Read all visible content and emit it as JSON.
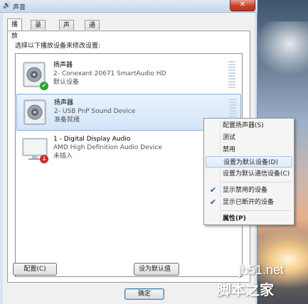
{
  "window": {
    "title": "声音",
    "close_glyph": "✕"
  },
  "tabs": [
    {
      "label": "播放",
      "active": true
    },
    {
      "label": "录制",
      "active": false
    },
    {
      "label": "声音",
      "active": false
    },
    {
      "label": "通信",
      "active": false
    }
  ],
  "prompt": "选择以下播放设备来修改设置:",
  "devices": [
    {
      "name": "扬声器",
      "desc": "2- Conexant 20671 SmartAudio HD",
      "status": "默认设备",
      "icon": "speaker-icon",
      "badge": "checkmark",
      "badge_color": "#2aa52a"
    },
    {
      "name": "扬声器",
      "desc": "2- USB PnP Sound Device",
      "status": "准备就绪",
      "icon": "speaker-icon",
      "selected": true
    },
    {
      "name": "1 - Digital Display Audio",
      "desc": "AMD High Definition Audio Device",
      "status": "未插入",
      "icon": "monitor-icon",
      "badge": "down-arrow",
      "badge_color": "#d12a2a"
    }
  ],
  "buttons": {
    "configure": "配置(C)",
    "set_default": "设为默认值",
    "ok": "确定"
  },
  "context_menu": [
    {
      "label": "配置扬声器(S)"
    },
    {
      "label": "测试"
    },
    {
      "label": "禁用"
    },
    {
      "label": "设置为默认设备(D)",
      "highlighted": true
    },
    {
      "label": "设置为默认通信设备(C)"
    },
    {
      "separator": true
    },
    {
      "label": "显示禁用的设备",
      "checked": true
    },
    {
      "label": "显示已断开的设备",
      "checked": true
    },
    {
      "separator": true
    },
    {
      "label": "属性(P)",
      "bold": true
    }
  ],
  "checkmark": "✔",
  "watermark": {
    "site": "jb51.net",
    "brand": "脚本之家"
  },
  "colors": {
    "selection": "#d3e5fa",
    "menu_highlight": "#dce9f8",
    "close": "#c9412a"
  }
}
